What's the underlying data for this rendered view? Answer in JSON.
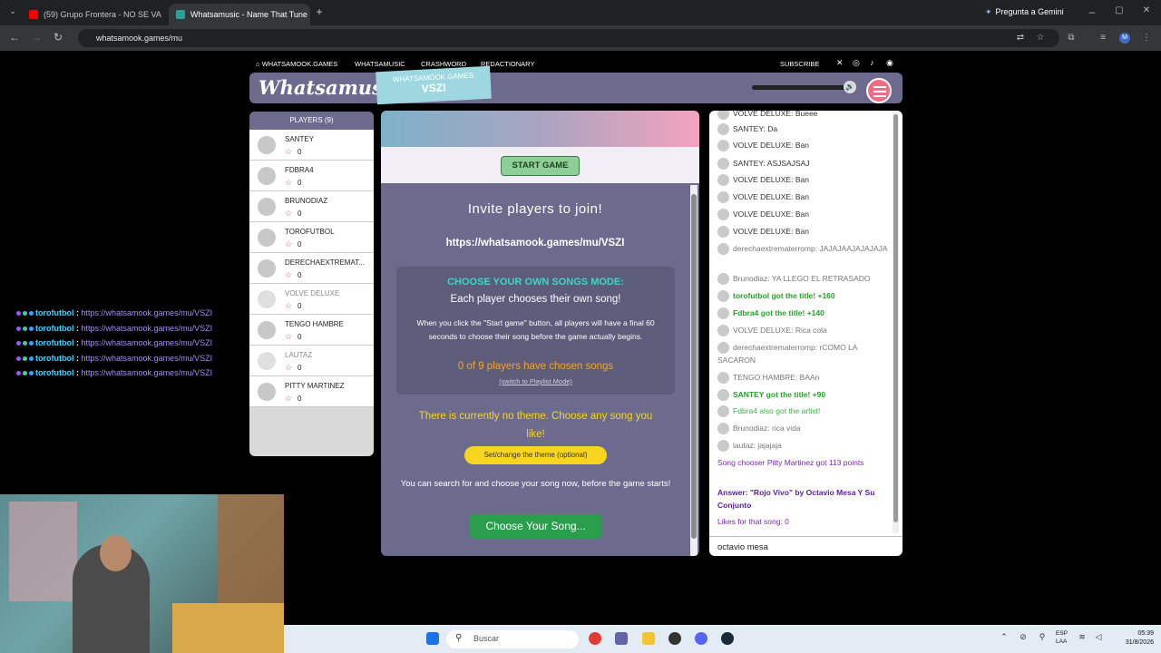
{
  "browser": {
    "tabs": [
      {
        "title": "(59) Grupo Frontera - NO SE VA",
        "active": false
      },
      {
        "title": "Whatsamusic - Name That Tune",
        "active": true
      }
    ],
    "new_tab": "+",
    "url": "whatsamook.games/mu",
    "gemini_label": "Pregunta a Gemini"
  },
  "stream_chat": {
    "lines": [
      {
        "user": "torofutbol",
        "sep": ":",
        "link": "https://whatsamook.games/mu/VSZI"
      },
      {
        "user": "torofutbol",
        "sep": ":",
        "link": "https://whatsamook.games/mu/VSZI"
      },
      {
        "user": "torofutbol",
        "sep": ":",
        "link": "https://whatsamook.games/mu/VSZI"
      },
      {
        "user": "torofutbol",
        "sep": ":",
        "link": "https://whatsamook.games/mu/VSZI"
      },
      {
        "user": "torofutbol",
        "sep": ":",
        "link": "https://whatsamook.games/mu/VSZI"
      }
    ]
  },
  "site_nav": {
    "home": "WHATSAMOOK.GAMES",
    "music": "WHATSAMUSIC",
    "crash": "CRASHWORD",
    "redact": "REDACTIONARY",
    "subscribe": "SUBSCRIBE"
  },
  "header": {
    "logo": "Whatsamusic",
    "room_site": "WHATSAMOOK.GAMES",
    "room_code": "VSZI"
  },
  "players": {
    "title": "PLAYERS (9)",
    "list": [
      {
        "name": "SANTEY",
        "score": "0"
      },
      {
        "name": "FDBRA4",
        "score": "0"
      },
      {
        "name": "BRUNODIAZ",
        "score": "0"
      },
      {
        "name": "TOROFUTBOL",
        "score": "0"
      },
      {
        "name": "DERECHAEXTREMAT...",
        "score": "0"
      },
      {
        "name": "VOLVE DELUXE",
        "score": "0"
      },
      {
        "name": "TENGO HAMBRE",
        "score": "0"
      },
      {
        "name": "LAUTAZ",
        "score": "0"
      },
      {
        "name": "PITTY MARTINEZ",
        "score": "0"
      }
    ]
  },
  "main": {
    "start_button": "START GAME",
    "invite_title": "Invite players to join!",
    "invite_url": "https://whatsamook.games/mu/VSZI",
    "mode_title": "CHOOSE YOUR OWN SONGS MODE:",
    "mode_subtitle": "Each player chooses their own song!",
    "mode_desc": "When you click the \"Start game\" button, all players will have a final 60 seconds to choose their song before the game actually begins.",
    "chosen_count": "0 of 9 players have chosen songs",
    "switch_link": "(switch to Playlist Mode)",
    "theme_text": "There is currently no theme. Choose any song you like!",
    "theme_button": "Set/change the theme (optional)",
    "search_text": "You can search for and choose your song now, before the game starts!",
    "choose_button": "Choose Your Song..."
  },
  "chat": {
    "messages": [
      {
        "text": "VOLVE DELUXE: Bueee",
        "style": ""
      },
      {
        "text": "SANTEY: Da",
        "style": ""
      },
      {
        "text": "VOLVE DELUXE: Ban",
        "style": ""
      },
      {
        "text": "SANTEY: ASJSAJSAJ",
        "style": ""
      },
      {
        "text": "VOLVE DELUXE: Ban",
        "style": ""
      },
      {
        "text": "VOLVE DELUXE: Ban",
        "style": ""
      },
      {
        "text": "VOLVE DELUXE: Ban",
        "style": ""
      },
      {
        "text": "VOLVE DELUXE: Ban",
        "style": ""
      },
      {
        "text": "derechaextrematerromp: JAJAJAAJAJAJAJA",
        "style": "gray"
      },
      {
        "text": "Brunodiaz: YA LLEGO EL RETRASADO",
        "style": "gray"
      },
      {
        "text": "torofutbol got the title! +160",
        "style": "green"
      },
      {
        "text": "Fdbra4 got the title! +140",
        "style": "green"
      },
      {
        "text": "VOLVE DELUXE: Rica cola",
        "style": "gray"
      },
      {
        "text": "derechaextrematerromp: rCOMO LA SACARON",
        "style": "gray"
      },
      {
        "text": "TENGO HAMBRE: BAAn",
        "style": "gray"
      },
      {
        "text": "SANTEY got the title! +90",
        "style": "green"
      },
      {
        "text": "Fdbra4 also got the artist!",
        "style": "lgreen"
      },
      {
        "text": "Brunodiaz: rica vida",
        "style": "gray"
      },
      {
        "text": "lautaz: jajajaja",
        "style": "gray"
      },
      {
        "text": "Song chooser Pitty Martinez got 113 points",
        "style": "purple"
      },
      {
        "text": "Answer: \"Rojo Vivo\" by Octavio Mesa Y Su Conjunto",
        "style": "bpurple"
      },
      {
        "text": "Likes for that song: 0",
        "style": "purple"
      }
    ],
    "input_value": "octavio mesa"
  },
  "taskbar": {
    "search_placeholder": "Buscar",
    "lang_top": "ESP",
    "lang_bottom": "LAA",
    "time": "05:39",
    "date": "31/8/2026"
  },
  "colors": {
    "panel": "#6c6b8e",
    "accent_pink": "#f06b84",
    "start_green": "#8ecf97",
    "theme_yellow": "#f8d51e",
    "choose_green": "#2b9e4d"
  }
}
